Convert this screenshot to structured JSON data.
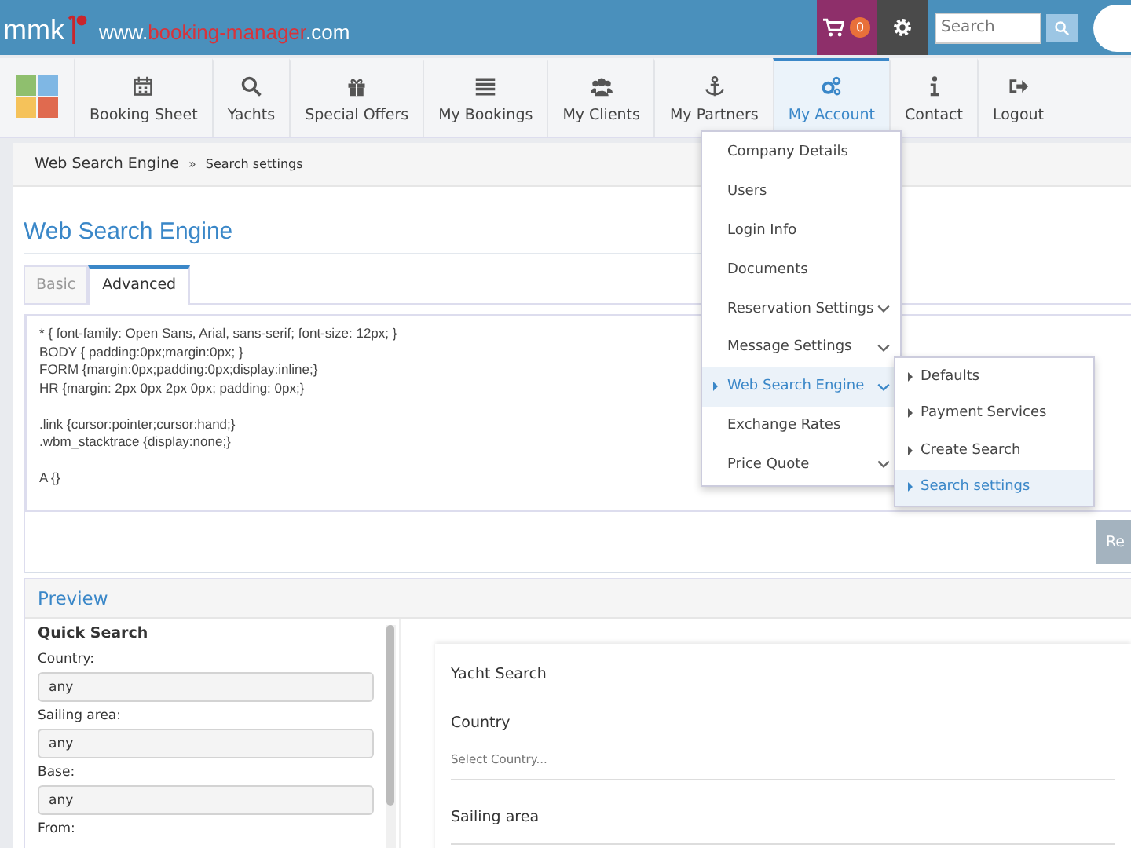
{
  "header": {
    "brand": "mmk",
    "url": [
      "www.",
      "booking-manager",
      ".com"
    ],
    "cart_count": "0",
    "search": {
      "placeholder": "Search"
    }
  },
  "nav": [
    {
      "label": "Booking Sheet",
      "selected": false
    },
    {
      "label": "Yachts",
      "selected": false
    },
    {
      "label": "Special Offers",
      "selected": false
    },
    {
      "label": "My Bookings",
      "selected": false
    },
    {
      "label": "My Clients",
      "selected": false
    },
    {
      "label": "My Partners",
      "selected": false
    },
    {
      "label": "My Account",
      "selected": true
    },
    {
      "label": "Contact",
      "selected": false
    },
    {
      "label": "Logout",
      "selected": false
    }
  ],
  "breadcrumb": [
    "Web Search Engine",
    "»",
    "Search settings"
  ],
  "page_title": "Web Search Engine",
  "tabs": [
    {
      "label": "Basic",
      "selected": false
    },
    {
      "label": "Advanced",
      "selected": true
    }
  ],
  "css_code": [
    [
      "* { font-family: Open Sans, Arial, sans-serif;  font-size: 12px; }",
      "BODY { padding:0px;margin:0px; }",
      "FORM {margin:0px;padding:0px;display:inline;}",
      "HR {margin: 2px 0px 2px 0px; padding: 0px;}"
    ],
    [
      ".link {cursor:pointer;cursor:hand;}",
      ".wbm_stacktrace {display:none;}"
    ],
    [
      "A {}"
    ]
  ],
  "action_button": "Re",
  "preview": {
    "title": "Preview",
    "quick_search": {
      "title": "Quick Search",
      "fields": [
        {
          "label": "Country:",
          "value": "any"
        },
        {
          "label": "Sailing area:",
          "value": "any"
        },
        {
          "label": "Base:",
          "value": "any"
        }
      ],
      "last_label": "From:"
    },
    "yacht_search": {
      "title": "Yacht Search",
      "fields": [
        {
          "label": "Country",
          "placeholder": "Select Country..."
        },
        {
          "label": "Sailing area"
        }
      ]
    }
  },
  "account_menu": [
    {
      "label": "Company Details",
      "submenu": false,
      "selected": false
    },
    {
      "label": "Users",
      "submenu": false,
      "selected": false
    },
    {
      "label": "Login Info",
      "submenu": false,
      "selected": false
    },
    {
      "label": "Documents",
      "submenu": false,
      "selected": false
    },
    {
      "label": "Reservation Settings",
      "submenu": true,
      "selected": false
    },
    {
      "label": "Message Settings",
      "submenu": true,
      "selected": false
    },
    {
      "label": "Web Search Engine",
      "submenu": true,
      "selected": true
    },
    {
      "label": "Exchange Rates",
      "submenu": false,
      "selected": false
    },
    {
      "label": "Price Quote",
      "submenu": true,
      "selected": false
    }
  ],
  "web_search_submenu": [
    {
      "label": "Defaults",
      "selected": false
    },
    {
      "label": "Payment Services",
      "selected": false
    },
    {
      "label": "Create Search",
      "selected": false
    },
    {
      "label": "Search settings",
      "selected": true
    }
  ]
}
